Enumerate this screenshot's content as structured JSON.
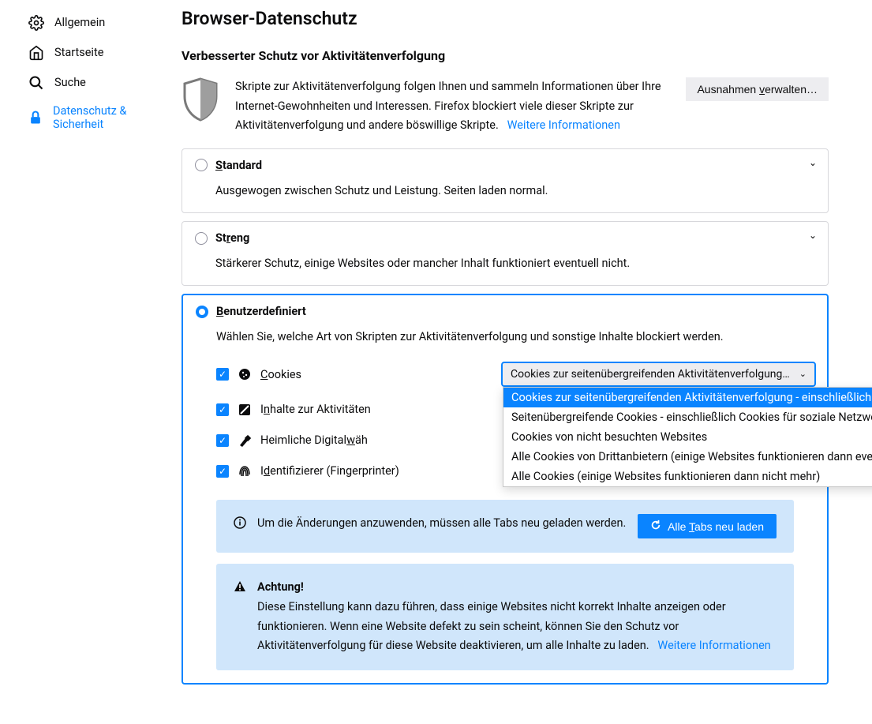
{
  "sidebar": {
    "items": [
      {
        "label": "Allgemein"
      },
      {
        "label": "Startseite"
      },
      {
        "label": "Suche"
      },
      {
        "label": "Datenschutz & Sicherheit"
      }
    ]
  },
  "page": {
    "title": "Browser-Datenschutz",
    "section_title": "Verbesserter Schutz vor Aktivitätenverfolgung",
    "intro_text": "Skripte zur Aktivitätenverfolgung folgen Ihnen und sammeln Informationen über Ihre Internet-Gewohnheiten und Interessen. Firefox blockiert viele dieser Skripte zur Aktivitätenverfolgung und andere böswillige Skripte.",
    "more_info": "Weitere Informationen",
    "exceptions_btn": "Ausnahmen verwalten…"
  },
  "panels": {
    "standard": {
      "title": "Standard",
      "desc": "Ausgewogen zwischen Schutz und Leistung. Seiten laden normal."
    },
    "strict": {
      "title": "Streng",
      "desc": "Stärkerer Schutz, einige Websites oder mancher Inhalt funktioniert eventuell nicht."
    },
    "custom": {
      "title": "Benutzerdefiniert",
      "desc": "Wählen Sie, welche Art von Skripten zur Aktivitätenverfolgung und sonstige Inhalte blockiert werden."
    }
  },
  "custom_rows": {
    "cookies": "Cookies",
    "tracking_content": "Inhalte zur Aktivitäten",
    "cryptominers": "Heimliche Digitalwäh",
    "fingerprinters": "Identifizierer (Fingerprinter)"
  },
  "cookie_select": {
    "selected": "Cookies zur seitenübergreifenden Aktivitätenverfolgung - ei…",
    "options": [
      "Cookies zur seitenübergreifenden Aktivitätenverfolgung - einschließlich Cookies für soziale Netzwerke",
      "Seitenübergreifende Cookies - einschließlich Cookies für soziale Netzwerke",
      "Cookies von nicht besuchten Websites",
      "Alle Cookies von Drittanbietern (einige Websites funktionieren dann eventuell nicht mehr)",
      "Alle Cookies (einige Websites funktionieren dann nicht mehr)"
    ]
  },
  "reload_box": {
    "text": "Um die Änderungen anzuwenden, müssen alle Tabs neu geladen werden.",
    "button": "Alle Tabs neu laden"
  },
  "warning_box": {
    "title": "Achtung!",
    "text": "Diese Einstellung kann dazu führen, dass einige Websites nicht korrekt Inhalte anzeigen oder funktionieren. Wenn eine Website defekt zu sein scheint, können Sie den Schutz vor Aktivitätenverfolgung für diese Website deaktivieren, um alle Inhalte zu laden.",
    "link": "Weitere Informationen"
  }
}
